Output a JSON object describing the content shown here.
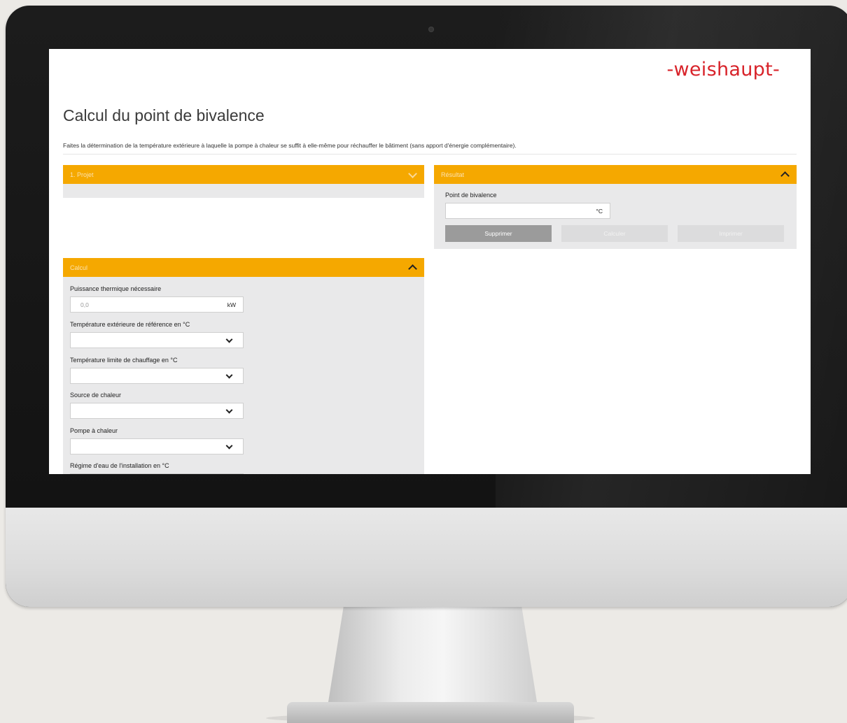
{
  "brand": {
    "logo_text": "-weishaupt-",
    "logo_color": "#d8232a",
    "accent_color": "#f5a800"
  },
  "page": {
    "title": "Calcul du point de bivalence",
    "intro": "Faites la détermination de la température extérieure à laquelle la pompe à chaleur se suffit à elle-même pour réchauffer le bâtiment (sans apport d'énergie complémentaire)."
  },
  "projet": {
    "header": "1. Projet",
    "collapsed": true
  },
  "resultat": {
    "header": "Résultat",
    "field_label": "Point de bivalence",
    "field_value": "",
    "field_unit": "°C",
    "buttons": {
      "delete": "Supprimer",
      "calculate": "Calculer",
      "print": "Imprimer"
    }
  },
  "calcul": {
    "header": "Calcul",
    "fields": [
      {
        "label": "Puissance thermique nécessaire",
        "placeholder": "0,0",
        "unit": "kW",
        "type": "input"
      },
      {
        "label": "Température extérieure de référence en °C",
        "value": "",
        "type": "select"
      },
      {
        "label": "Température limite de chauffage en °C",
        "value": "",
        "type": "select"
      },
      {
        "label": "Source de chaleur",
        "value": "",
        "type": "select"
      },
      {
        "label": "Pompe à chaleur",
        "value": "",
        "type": "select"
      },
      {
        "label": "Régime d'eau de l'installation en °C",
        "value": "",
        "type": "select"
      }
    ]
  }
}
